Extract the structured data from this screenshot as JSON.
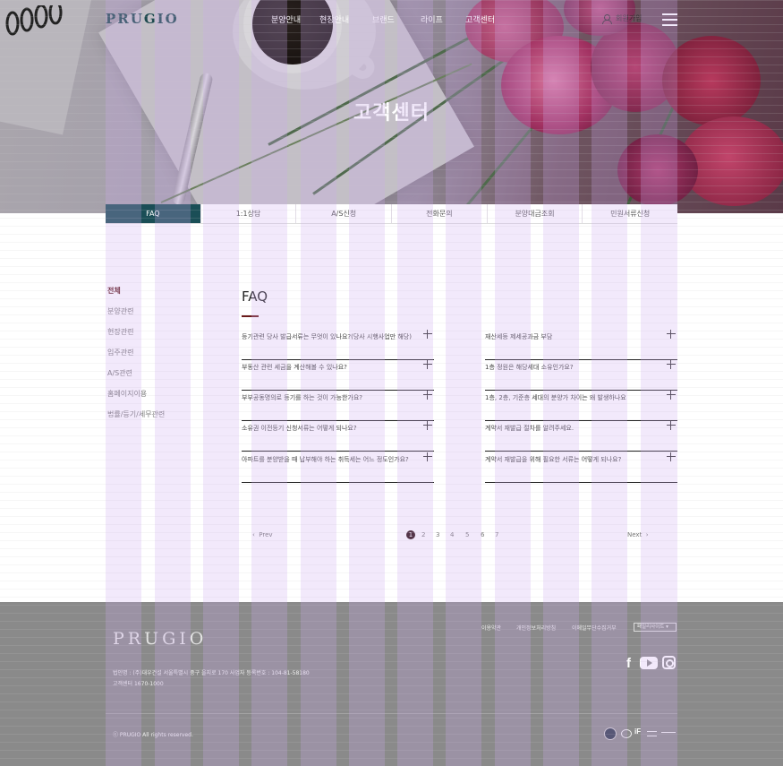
{
  "header": {
    "logo": "PRUGIO",
    "nav": [
      "분양안내",
      "현장안내",
      "브랜드",
      "라이프",
      "고객센터"
    ],
    "login": "회원가입"
  },
  "hero": {
    "title": "고객센터"
  },
  "tabs": [
    "FAQ",
    "1:1상담",
    "A/S신청",
    "전화문의",
    "분양대금조회",
    "민원서류신청"
  ],
  "side_nav": [
    "전체",
    "분양관련",
    "현장관련",
    "입주관련",
    "A/S관련",
    "홈페이지이용",
    "법률/등기/세무관련"
  ],
  "faq": {
    "title": "FAQ",
    "left": [
      "등기관련 당사 발급서류는 무엇이 있나요?(당사 시행사업만 해당)",
      "부동산 관련 세금을 계산해볼 수 있나요?",
      "부부공동명의로 등기를 하는 것이 가능한가요?",
      "소유권 이전등기 신청서류는 어떻게 되나요?",
      "아파트를 분양받을 때 납부해야 하는 취득세는 어느 정도인가요?"
    ],
    "right": [
      "재산세등 제세공과금 부담",
      "1층 정원은 해당세대 소유인가요?",
      "1층, 2층, 기준층 세대의 분양가 차이는 왜 발생하나요",
      "계약서 재발급 절차를 알려주세요.",
      "계약서 재발급을 위해 필요한 서류는 어떻게 되나요?"
    ]
  },
  "pagination": {
    "prev": "Prev",
    "next": "Next",
    "pages": [
      "1",
      "2",
      "3",
      "4",
      "5",
      "6",
      "7"
    ],
    "current": "1"
  },
  "footer": {
    "logo": "PRUGIO",
    "links": [
      "이용약관",
      "개인정보처리방침",
      "이메일무단수집거부"
    ],
    "family_site": "패밀리사이트 ▾",
    "info_line1": "법인명 : (주)대우건설 서울특별시 중구 을지로 170 사업자 등록번호 : 104-81-58180",
    "info_line2": "고객센터 1670-1000",
    "copyright": "ⓒ PRUGIO All rights reserved.",
    "sns": {
      "facebook": "f"
    }
  },
  "colors": {
    "accent": "#1a4e56",
    "active_menu": "#5a1216",
    "footer_bg": "#8a8a8a"
  }
}
